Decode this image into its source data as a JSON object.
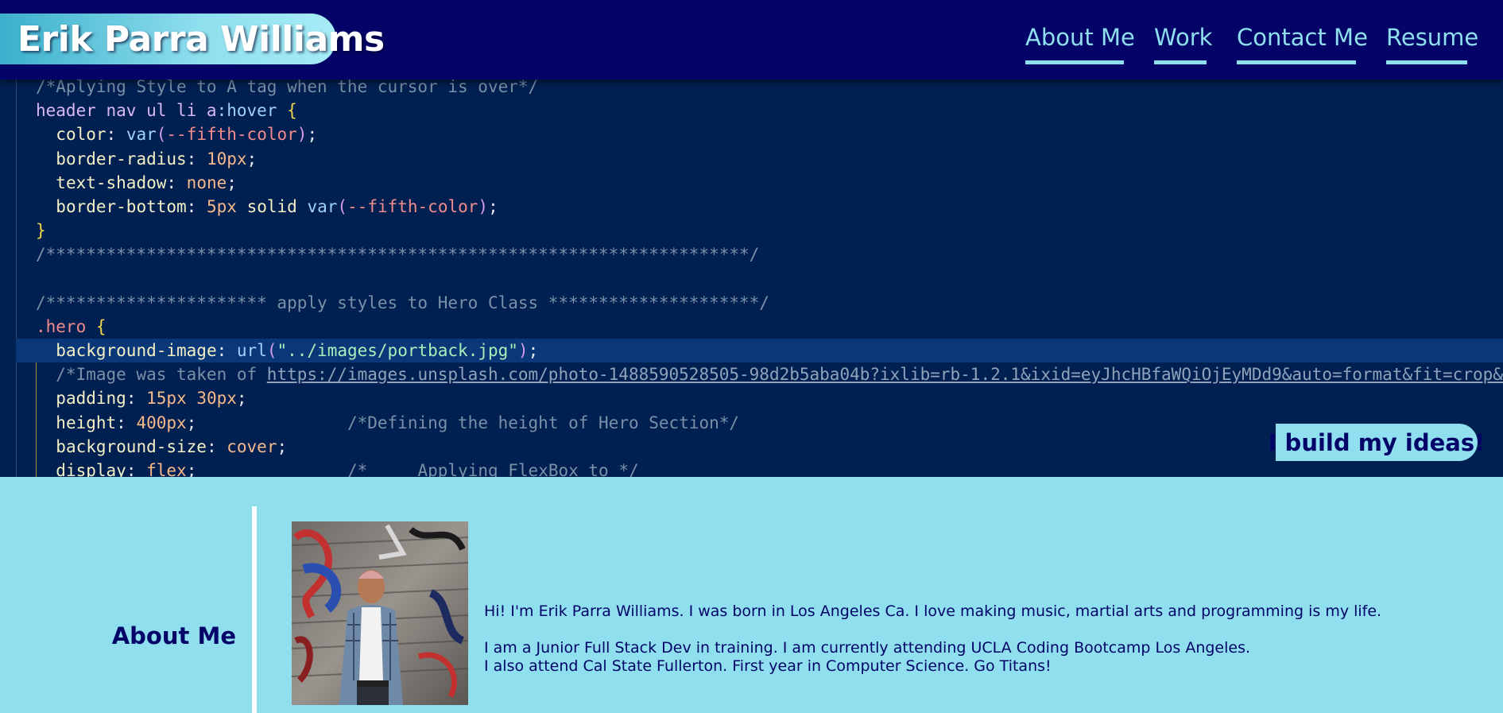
{
  "header": {
    "brand": "Erik Parra Williams",
    "nav": [
      {
        "label": "About Me"
      },
      {
        "label": "Work"
      },
      {
        "label": "Contact Me"
      },
      {
        "label": "Resume"
      }
    ]
  },
  "hero": {
    "code_lines": [
      "/*Aplying Style to A tag when the cursor is over*/",
      "header nav ul li a:hover {",
      "  color: var(--fifth-color);",
      "  border-radius: 10px;",
      "  text-shadow: none;",
      "  border-bottom: 5px solid var(--fifth-color);",
      "}",
      "/**********************************************************************/",
      "",
      "/********************** apply styles to Hero Class *********************/",
      ".hero {",
      "  background-image: url(\"../images/portback.jpg\");",
      "  /*Image was taken of https://images.unsplash.com/photo-1488590528505-98d2b5aba04b?ixlib=rb-1.2.1&ixid=eyJhcHBfaWQiOjEyMDd9&auto=format&fit=crop&w=",
      "  padding: 15px 30px;",
      "  height: 400px;               /*Defining the height of Hero Section*/",
      "  background-size: cover;",
      "  display: flex;               /*     Applying FlexBox to */"
    ],
    "tagline": "I build my ideas!"
  },
  "about": {
    "title": "About Me",
    "paragraphs": [
      "Hi! I'm Erik Parra Williams. I was born in Los Angeles Ca. I love making music, martial arts and programming is my life.",
      "I am a Junior Full Stack Dev in training. I am currently attending UCLA Coding Bootcamp Los Angeles.",
      "I also attend Cal State Fullerton. First year in Computer Science. Go Titans!"
    ]
  },
  "colors": {
    "header_bg": "#040468",
    "accent": "#8fdfee",
    "hero_bg": "#012052",
    "text_dark": "#040468"
  }
}
